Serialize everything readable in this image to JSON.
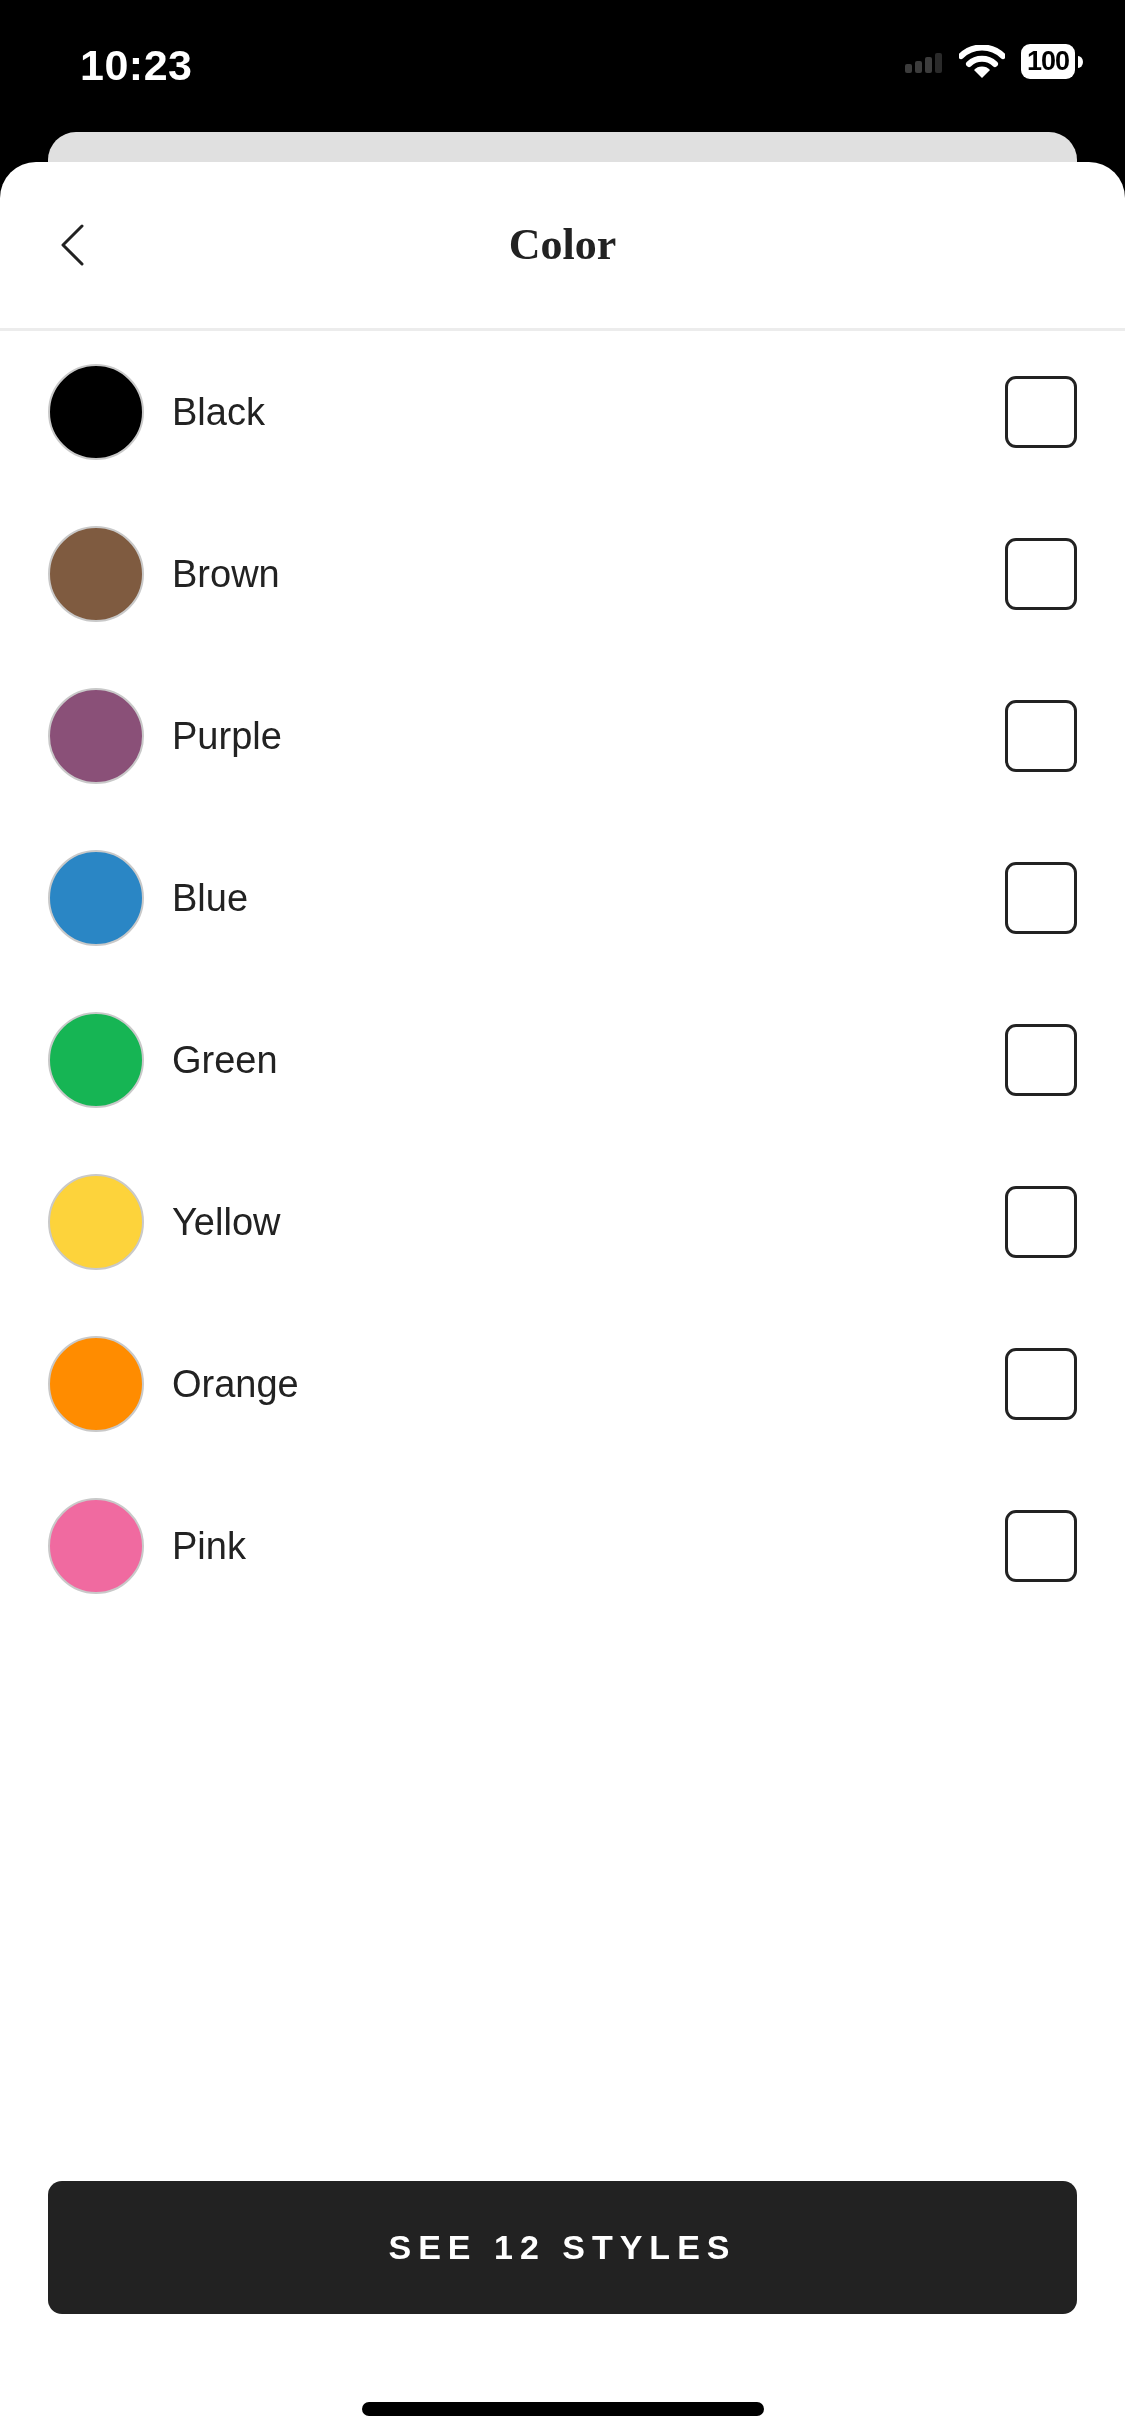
{
  "status_bar": {
    "time": "10:23",
    "battery": "100"
  },
  "header": {
    "title": "Color"
  },
  "colors": [
    {
      "label": "Black",
      "color": "#000000",
      "checked": false
    },
    {
      "label": "Brown",
      "color": "#7f5b40",
      "checked": false
    },
    {
      "label": "Purple",
      "color": "#8a5078",
      "checked": false
    },
    {
      "label": "Blue",
      "color": "#2a86c5",
      "checked": false
    },
    {
      "label": "Green",
      "color": "#16b554",
      "checked": false
    },
    {
      "label": "Yellow",
      "color": "#fdd33b",
      "checked": false
    },
    {
      "label": "Orange",
      "color": "#ff8c00",
      "checked": false
    },
    {
      "label": "Pink",
      "color": "#f06aa0",
      "checked": false
    }
  ],
  "primary_button": {
    "label": "SEE 12 STYLES"
  }
}
